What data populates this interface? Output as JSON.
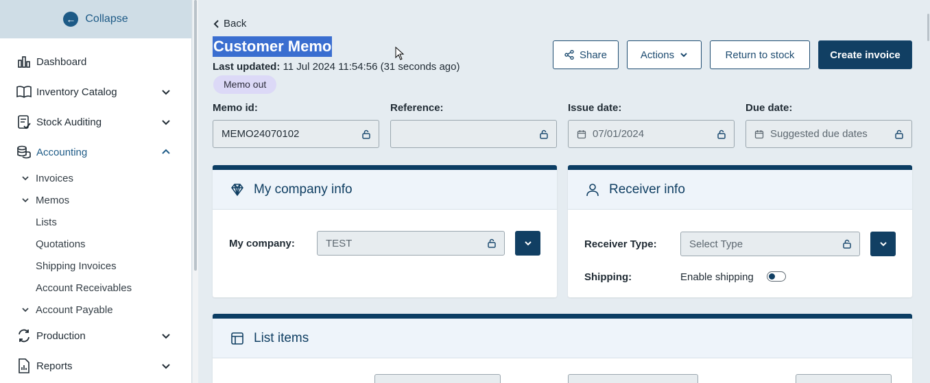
{
  "sidebar": {
    "collapse_label": "Collapse",
    "items": [
      {
        "label": "Dashboard"
      },
      {
        "label": "Inventory Catalog"
      },
      {
        "label": "Stock Auditing"
      },
      {
        "label": "Accounting"
      },
      {
        "label": "Production"
      },
      {
        "label": "Reports"
      }
    ],
    "accounting_sub": {
      "invoices": "Invoices",
      "memos": "Memos",
      "memos_children": [
        "Lists",
        "Quotations",
        "Shipping Invoices",
        "Account Receivables"
      ],
      "account_payable": "Account Payable"
    },
    "active_color": "#1d5a86"
  },
  "header": {
    "back_label": "Back",
    "title": "Customer Memo",
    "updated_label": "Last updated:",
    "updated_value": "11 Jul 2024 11:54:56 (31 seconds ago)",
    "status_badge": "Memo out"
  },
  "toolbar": {
    "share_label": "Share",
    "actions_label": "Actions",
    "return_label": "Return to stock",
    "invoice_label": "Create invoice"
  },
  "fields": {
    "memo_id": {
      "label": "Memo id:",
      "value": "MEMO24070102"
    },
    "reference": {
      "label": "Reference:",
      "value": ""
    },
    "issue_date": {
      "label": "Issue date:",
      "value": "07/01/2024"
    },
    "due_date": {
      "label": "Due date:",
      "placeholder": "Suggested due dates"
    }
  },
  "company_card": {
    "title": "My company info",
    "company_label": "My company:",
    "company_value": "TEST"
  },
  "receiver_card": {
    "title": "Receiver info",
    "type_label": "Receiver Type:",
    "type_placeholder": "Select Type",
    "shipping_label": "Shipping:",
    "shipping_toggle_label": "Enable shipping"
  },
  "list_card": {
    "title": "List items"
  },
  "colors": {
    "primary": "#113f63",
    "card_header": "#eef4fa",
    "badge": "#dcd9f7",
    "selection": "#3a6ed0"
  }
}
